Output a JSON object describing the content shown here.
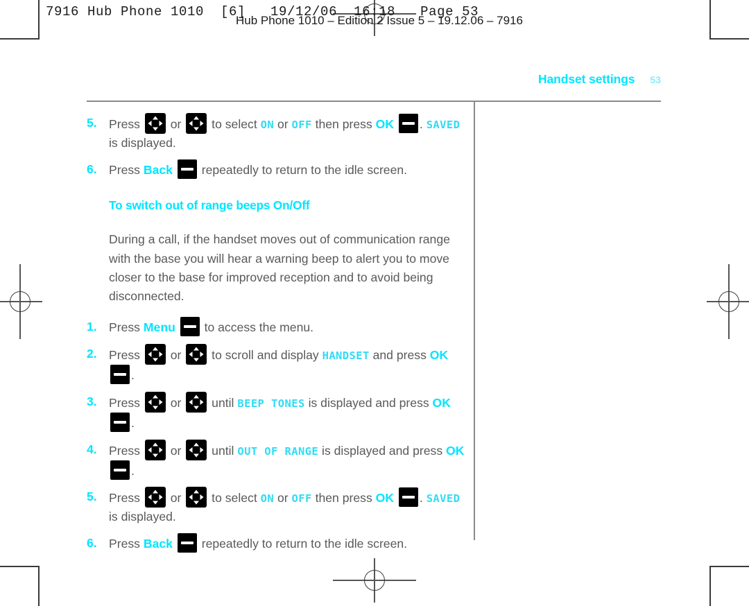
{
  "prepress": {
    "slug_line_1": "7916 Hub Phone 1010  [6]   19/12/06  16:18   Page 53",
    "slug_line_2": "Hub Phone 1010 – Edition 2 Issue 5 – 19.12.06 – 7916",
    "crop_mark_name": "crop-mark",
    "registration_mark_name": "registration-mark"
  },
  "running_head": {
    "title": "Handset settings",
    "page_number": "53",
    "title_color": "#00e5ff",
    "page_color": "#7df0ff"
  },
  "colors": {
    "accent_cyan": "#00e5ff",
    "lcd_cyan": "#2fdcf5",
    "body_gray": "#58595b",
    "rule_gray": "#8a8a8a",
    "key_black": "#000000"
  },
  "icons": {
    "nav_key": "navigation-key-icon",
    "soft_key": "soft-key-icon"
  },
  "top_steps": [
    {
      "number": "5.",
      "segments": [
        {
          "type": "text",
          "value": "Press "
        },
        {
          "type": "nav-key"
        },
        {
          "type": "text",
          "value": " or "
        },
        {
          "type": "nav-key"
        },
        {
          "type": "text",
          "value": " to select "
        },
        {
          "type": "lcd",
          "value": "ON"
        },
        {
          "type": "text",
          "value": " or "
        },
        {
          "type": "lcd",
          "value": "OFF"
        },
        {
          "type": "text",
          "value": " then press "
        },
        {
          "type": "cyan",
          "value": "OK"
        },
        {
          "type": "text",
          "value": " "
        },
        {
          "type": "soft-key"
        },
        {
          "type": "text",
          "value": ". "
        },
        {
          "type": "lcd",
          "value": "SAVED"
        },
        {
          "type": "text",
          "value": " is displayed."
        }
      ]
    },
    {
      "number": "6.",
      "segments": [
        {
          "type": "text",
          "value": "Press "
        },
        {
          "type": "cyan",
          "value": "Back"
        },
        {
          "type": "text",
          "value": " "
        },
        {
          "type": "soft-key"
        },
        {
          "type": "text",
          "value": " repeatedly to return to the idle screen."
        }
      ]
    }
  ],
  "section": {
    "heading": "To switch out of range beeps On/Off",
    "paragraph": "During a call, if the handset moves out of communication range with the base you will hear a warning beep to alert you to move closer to the base for improved reception and to avoid being disconnected."
  },
  "steps": [
    {
      "number": "1.",
      "segments": [
        {
          "type": "text",
          "value": "Press "
        },
        {
          "type": "cyan",
          "value": "Menu"
        },
        {
          "type": "text",
          "value": " "
        },
        {
          "type": "soft-key"
        },
        {
          "type": "text",
          "value": " to access the menu."
        }
      ]
    },
    {
      "number": "2.",
      "segments": [
        {
          "type": "text",
          "value": "Press "
        },
        {
          "type": "nav-key"
        },
        {
          "type": "text",
          "value": " or "
        },
        {
          "type": "nav-key"
        },
        {
          "type": "text",
          "value": " to scroll and display "
        },
        {
          "type": "lcd",
          "value": "HANDSET"
        },
        {
          "type": "text",
          "value": " and press "
        },
        {
          "type": "cyan",
          "value": "OK"
        },
        {
          "type": "text",
          "value": " "
        },
        {
          "type": "soft-key"
        },
        {
          "type": "text",
          "value": "."
        }
      ]
    },
    {
      "number": "3.",
      "segments": [
        {
          "type": "text",
          "value": "Press "
        },
        {
          "type": "nav-key"
        },
        {
          "type": "text",
          "value": " or "
        },
        {
          "type": "nav-key"
        },
        {
          "type": "text",
          "value": " until "
        },
        {
          "type": "lcd",
          "value": "BEEP TONES"
        },
        {
          "type": "text",
          "value": " is displayed and press "
        },
        {
          "type": "cyan",
          "value": "OK"
        },
        {
          "type": "text",
          "value": " "
        },
        {
          "type": "soft-key"
        },
        {
          "type": "text",
          "value": "."
        }
      ]
    },
    {
      "number": "4.",
      "segments": [
        {
          "type": "text",
          "value": "Press "
        },
        {
          "type": "nav-key"
        },
        {
          "type": "text",
          "value": " or "
        },
        {
          "type": "nav-key"
        },
        {
          "type": "text",
          "value": " until "
        },
        {
          "type": "lcd",
          "value": "OUT OF RANGE"
        },
        {
          "type": "text",
          "value": " is displayed and press "
        },
        {
          "type": "cyan",
          "value": "OK"
        },
        {
          "type": "text",
          "value": " "
        },
        {
          "type": "soft-key"
        },
        {
          "type": "text",
          "value": "."
        }
      ]
    },
    {
      "number": "5.",
      "segments": [
        {
          "type": "text",
          "value": "Press "
        },
        {
          "type": "nav-key"
        },
        {
          "type": "text",
          "value": " or "
        },
        {
          "type": "nav-key"
        },
        {
          "type": "text",
          "value": " to select "
        },
        {
          "type": "lcd",
          "value": "ON"
        },
        {
          "type": "text",
          "value": " or "
        },
        {
          "type": "lcd",
          "value": "OFF"
        },
        {
          "type": "text",
          "value": " then press "
        },
        {
          "type": "cyan",
          "value": "OK"
        },
        {
          "type": "text",
          "value": " "
        },
        {
          "type": "soft-key"
        },
        {
          "type": "text",
          "value": ". "
        },
        {
          "type": "lcd",
          "value": "SAVED"
        },
        {
          "type": "text",
          "value": " is displayed."
        }
      ]
    },
    {
      "number": "6.",
      "segments": [
        {
          "type": "text",
          "value": "Press "
        },
        {
          "type": "cyan",
          "value": "Back"
        },
        {
          "type": "text",
          "value": " "
        },
        {
          "type": "soft-key"
        },
        {
          "type": "text",
          "value": " repeatedly to return to the idle screen."
        }
      ]
    }
  ]
}
